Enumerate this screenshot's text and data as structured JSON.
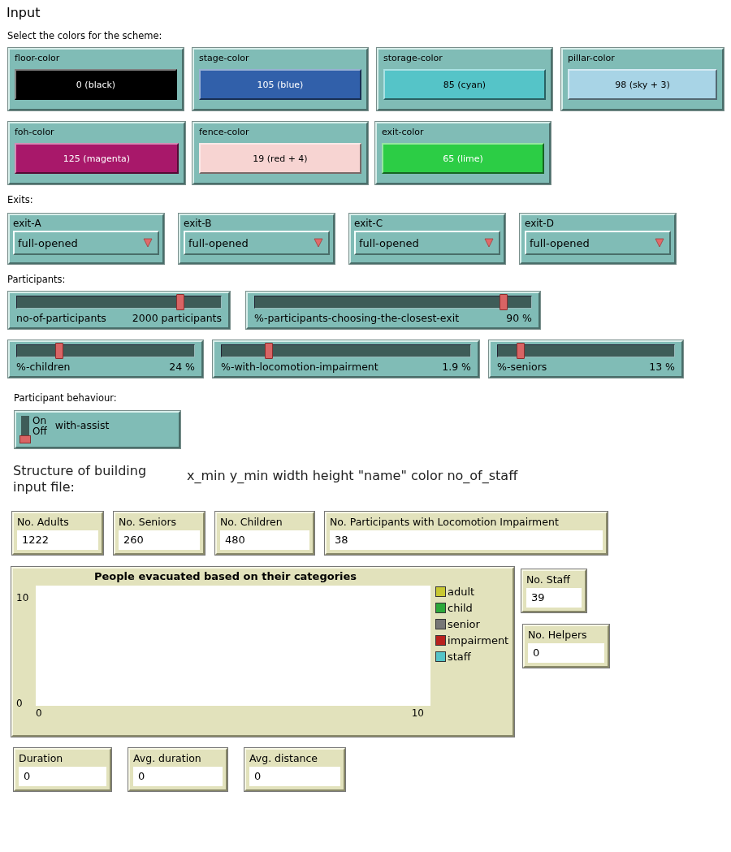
{
  "heading": "Input",
  "colors_label": "Select the colors for the scheme:",
  "color_choosers": [
    {
      "label": "floor-color",
      "value": "0 (black)",
      "color": "#000000"
    },
    {
      "label": "stage-color",
      "value": "105 (blue)",
      "color": "#3160aa"
    },
    {
      "label": "storage-color",
      "value": "85 (cyan)",
      "color": "#55c4c8"
    },
    {
      "label": "pillar-color",
      "value": "98 (sky + 3)",
      "color": "#a8d4e6"
    },
    {
      "label": "foh-color",
      "value": "125 (magenta)",
      "color": "#a8186a"
    },
    {
      "label": "fence-color",
      "value": "19 (red + 4)",
      "color": "#f7d4d2"
    },
    {
      "label": "exit-color",
      "value": "65 (lime)",
      "color": "#2ccd45"
    }
  ],
  "exits_label": "Exits:",
  "exits": [
    {
      "label": "exit-A",
      "value": "full-opened"
    },
    {
      "label": "exit-B",
      "value": "full-opened"
    },
    {
      "label": "exit-C",
      "value": "full-opened"
    },
    {
      "label": "exit-D",
      "value": "full-opened"
    }
  ],
  "participants_label": "Participants:",
  "sliders": [
    {
      "label": "no-of-participants",
      "reading": "2000 participants",
      "level": 0.8
    },
    {
      "label": "%-participants-choosing-the-closest-exit",
      "reading": "90 %",
      "level": 0.9
    },
    {
      "label": "%-children",
      "reading": "24 %",
      "level": 0.24
    },
    {
      "label": "%-with-locomotion-impairment",
      "reading": "1.9 %",
      "level": 0.19
    },
    {
      "label": "%-seniors",
      "reading": "13 %",
      "level": 0.13
    }
  ],
  "behaviour_label": "Participant behaviour:",
  "switch": {
    "on_label": "On",
    "off_label": "Off",
    "label": "with-assist",
    "on": false
  },
  "structure_label": "Structure of building input file:",
  "structure_format": "x_min y_min width height \"name\" color no_of_staff",
  "monitors": [
    {
      "label": "No. Adults",
      "value": "1222"
    },
    {
      "label": "No. Seniors",
      "value": "260"
    },
    {
      "label": "No. Children",
      "value": "480"
    },
    {
      "label": "No. Participants with Locomotion Impairment",
      "value": "38"
    }
  ],
  "plot": {
    "title": "People evacuated based on their categories",
    "y_max": "10",
    "y_min": "0",
    "x_min": "0",
    "x_max": "10",
    "legend": [
      {
        "name": "adult",
        "color": "#c8c832"
      },
      {
        "name": "child",
        "color": "#2ca83a"
      },
      {
        "name": "senior",
        "color": "#777777"
      },
      {
        "name": "impairment",
        "color": "#b8221e"
      },
      {
        "name": "staff",
        "color": "#55c4c8"
      }
    ]
  },
  "side_monitors": [
    {
      "label": "No. Staff",
      "value": "39"
    },
    {
      "label": "No. Helpers",
      "value": "0"
    }
  ],
  "bottom_monitors": [
    {
      "label": "Duration",
      "value": "0"
    },
    {
      "label": "Avg. duration",
      "value": "0"
    },
    {
      "label": "Avg. distance",
      "value": "0"
    }
  ]
}
